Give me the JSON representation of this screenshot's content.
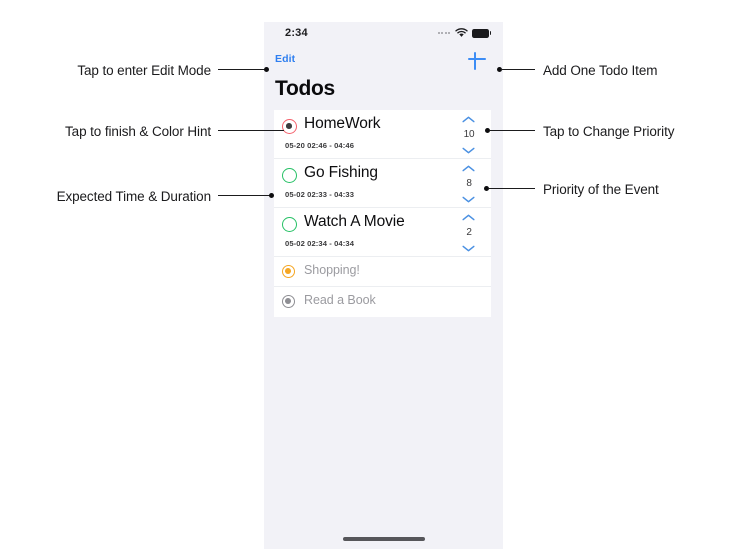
{
  "top_cut_text": "'  '         ' '      '      '",
  "phone": {
    "status_bar": {
      "time": "2:34",
      "signal_icon": "signal-dots-icon",
      "wifi_icon": "wifi-icon",
      "battery_icon": "battery-icon"
    },
    "nav": {
      "edit_label": "Edit",
      "add_icon": "plus-icon"
    },
    "title": "Todos",
    "todos": [
      {
        "title": "HomeWork",
        "schedule": "05-20 02:46 - 04:46",
        "priority": "10",
        "state": "active",
        "ring_color": "#f4626d",
        "inner_color": "#3b3b3d",
        "filled": true
      },
      {
        "title": "Go Fishing",
        "schedule": "05-02 02:33 - 04:33",
        "priority": "8",
        "state": "active",
        "ring_color": "#27c166",
        "inner_color": "transparent",
        "filled": false
      },
      {
        "title": "Watch A Movie",
        "schedule": "05-02 02:34 - 04:34",
        "priority": "2",
        "state": "active",
        "ring_color": "#27c166",
        "inner_color": "transparent",
        "filled": false
      }
    ],
    "completed": [
      {
        "title": "Shopping!",
        "ring_color": "#f5a623",
        "inner_color": "#f5a623",
        "filled": true
      },
      {
        "title": "Read a Book",
        "ring_color": "#8e8e93",
        "inner_color": "#8e8e93",
        "filled": true
      }
    ],
    "stepper": {
      "up_icon": "chevron-up-icon",
      "down_icon": "chevron-down-icon",
      "chevron_color": "#4a90e2"
    },
    "home_indicator": "home-indicator"
  },
  "annotations": {
    "left": [
      "Tap to enter Edit Mode",
      "Tap to finish & Color Hint",
      "Expected Time & Duration"
    ],
    "right": [
      "Add One Todo Item",
      "Tap to Change Priority",
      "Priority of the Event"
    ]
  },
  "colors": {
    "accent_blue": "#3d8df5",
    "edit_blue": "#2f7ff0",
    "phone_bg": "#f2f2f7",
    "card_bg": "#ffffff",
    "muted_text": "#9b9ba0"
  }
}
